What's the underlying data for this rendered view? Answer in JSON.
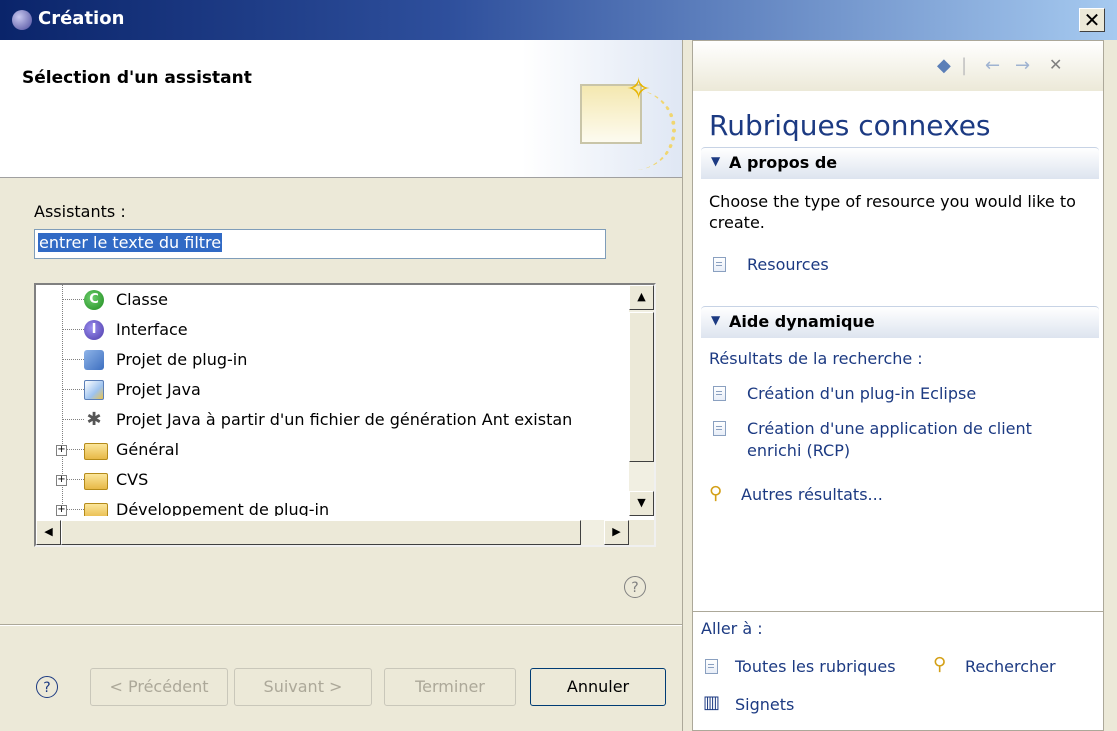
{
  "window": {
    "title": "Création",
    "close_label": "✕"
  },
  "wizard": {
    "header_title": "Sélection d'un assistant",
    "assistants_label": "Assistants :",
    "filter_value": "entrer le texte du filtre",
    "tree_items": [
      {
        "label": "Classe",
        "icon": "java-class-icon",
        "expandable": false
      },
      {
        "label": "Interface",
        "icon": "java-interface-icon",
        "expandable": false
      },
      {
        "label": "Projet de plug-in",
        "icon": "plugin-project-icon",
        "expandable": false
      },
      {
        "label": "Projet Java",
        "icon": "java-project-icon",
        "expandable": false
      },
      {
        "label": "Projet Java à partir d'un fichier de génération Ant existan",
        "icon": "ant-project-icon",
        "expandable": false
      },
      {
        "label": "Général",
        "icon": "folder-icon",
        "expandable": true
      },
      {
        "label": "CVS",
        "icon": "folder-icon",
        "expandable": true
      },
      {
        "label": "Développement de plug-in",
        "icon": "folder-icon",
        "expandable": true
      }
    ],
    "buttons": {
      "back": "< Précédent",
      "next": "Suivant >",
      "finish": "Terminer",
      "cancel": "Annuler"
    },
    "help_glyph": "?"
  },
  "help_panel": {
    "title": "Rubriques connexes",
    "about": {
      "heading": "A propos de",
      "text": "Choose the type of resource you would like to create.",
      "link": "Resources"
    },
    "dynamic": {
      "heading": "Aide dynamique",
      "results_label": "Résultats de la recherche :",
      "links": [
        "Création d'un plug-in Eclipse",
        "Création d'une application de client enrichi (RCP)"
      ],
      "more": "Autres résultats..."
    },
    "goto": {
      "label": "Aller à :",
      "all_topics": "Toutes les rubriques",
      "search": "Rechercher",
      "bookmarks": "Signets"
    }
  }
}
